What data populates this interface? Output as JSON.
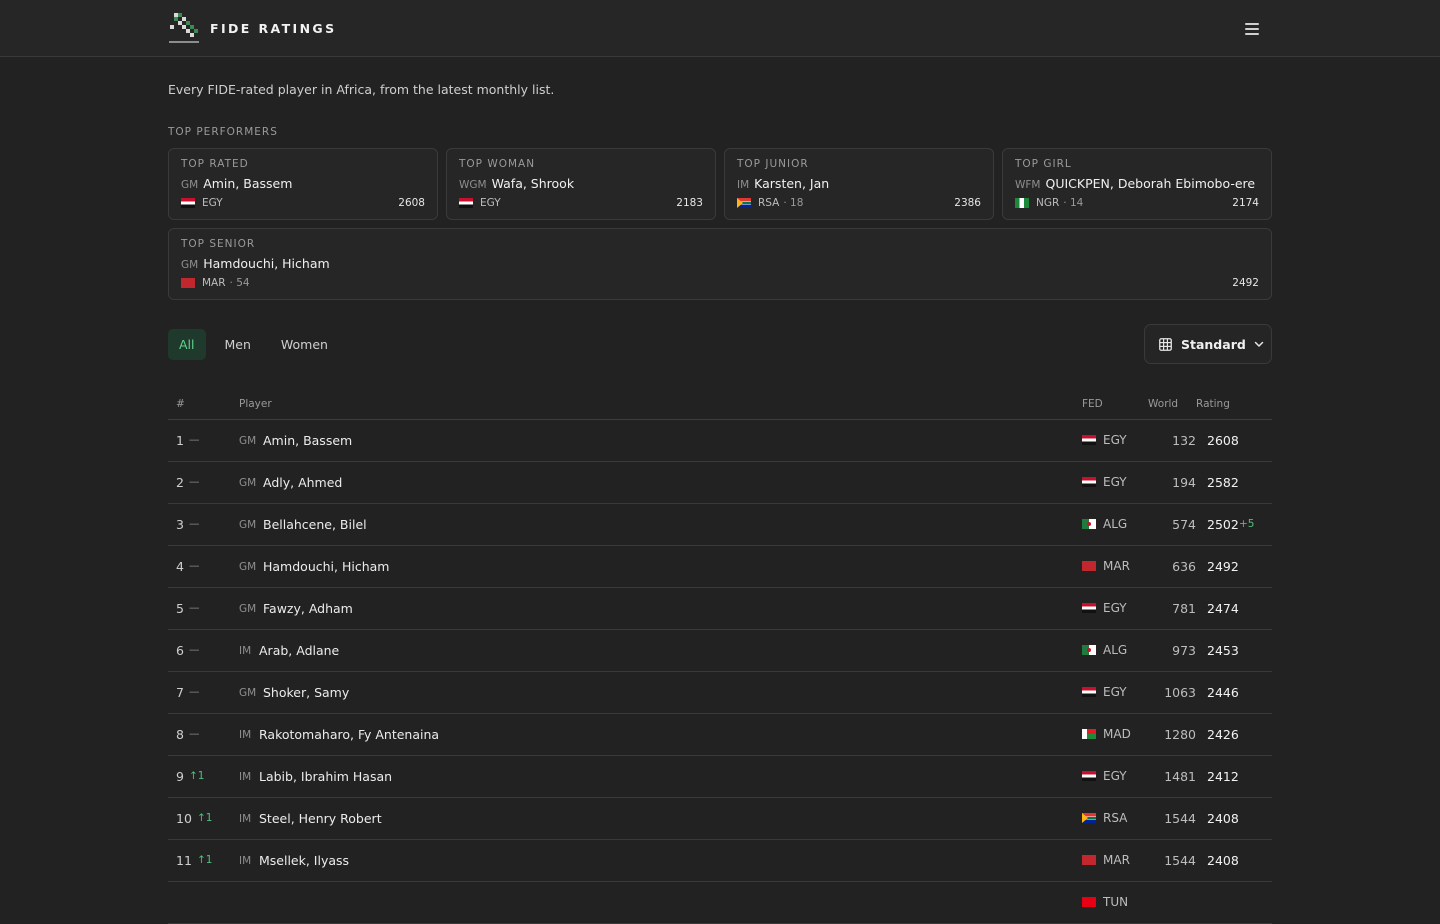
{
  "app": {
    "brand_name": "FIDE RATINGS",
    "menu_icon": "hamburger-menu-icon",
    "logo_icon": "chess-flag-logo"
  },
  "intro": "Every FIDE-rated player in Africa, from the latest monthly list.",
  "performers": {
    "label": "TOP PERFORMERS",
    "cards": [
      {
        "heading": "TOP RATED",
        "title": "GM",
        "name": "Amin, Bassem",
        "fed": "EGY",
        "age": "",
        "rating": "2608",
        "flag": "egy"
      },
      {
        "heading": "TOP WOMAN",
        "title": "WGM",
        "name": "Wafa, Shrook",
        "fed": "EGY",
        "age": "",
        "rating": "2183",
        "flag": "egy"
      },
      {
        "heading": "TOP JUNIOR",
        "title": "IM",
        "name": "Karsten, Jan",
        "fed": "RSA",
        "age": "· 18",
        "rating": "2386",
        "flag": "rsa"
      },
      {
        "heading": "TOP GIRL",
        "title": "WFM",
        "name": "QUICKPEN, Deborah Ebimobo-ere",
        "fed": "NGR",
        "age": "· 14",
        "rating": "2174",
        "flag": "ngr"
      },
      {
        "heading": "TOP SENIOR",
        "title": "GM",
        "name": "Hamdouchi, Hicham",
        "fed": "MAR",
        "age": "· 54",
        "rating": "2492",
        "flag": "mar"
      }
    ]
  },
  "filters": {
    "tabs": [
      "All",
      "Men",
      "Women"
    ],
    "active_tab": "All",
    "format_select": {
      "label": "Standard",
      "icon": "grid-icon",
      "chevron": "chevron-down-icon"
    }
  },
  "table": {
    "headers": {
      "rank": "#",
      "player": "Player",
      "fed": "FED",
      "world": "World",
      "rating": "Rating"
    },
    "rows": [
      {
        "rank": "1",
        "move": "—",
        "title": "GM",
        "name": "Amin, Bassem",
        "fed": "EGY",
        "world": "132",
        "rating": "2608",
        "delta": "",
        "flag": "egy"
      },
      {
        "rank": "2",
        "move": "—",
        "title": "GM",
        "name": "Adly, Ahmed",
        "fed": "EGY",
        "world": "194",
        "rating": "2582",
        "delta": "",
        "flag": "egy"
      },
      {
        "rank": "3",
        "move": "—",
        "title": "GM",
        "name": "Bellahcene, Bilel",
        "fed": "ALG",
        "world": "574",
        "rating": "2502",
        "delta": "+5",
        "flag": "alg"
      },
      {
        "rank": "4",
        "move": "—",
        "title": "GM",
        "name": "Hamdouchi, Hicham",
        "fed": "MAR",
        "world": "636",
        "rating": "2492",
        "delta": "",
        "flag": "mar"
      },
      {
        "rank": "5",
        "move": "—",
        "title": "GM",
        "name": "Fawzy, Adham",
        "fed": "EGY",
        "world": "781",
        "rating": "2474",
        "delta": "",
        "flag": "egy"
      },
      {
        "rank": "6",
        "move": "—",
        "title": "IM",
        "name": "Arab, Adlane",
        "fed": "ALG",
        "world": "973",
        "rating": "2453",
        "delta": "",
        "flag": "alg"
      },
      {
        "rank": "7",
        "move": "—",
        "title": "GM",
        "name": "Shoker, Samy",
        "fed": "EGY",
        "world": "1063",
        "rating": "2446",
        "delta": "",
        "flag": "egy"
      },
      {
        "rank": "8",
        "move": "—",
        "title": "IM",
        "name": "Rakotomaharo, Fy Antenaina",
        "fed": "MAD",
        "world": "1280",
        "rating": "2426",
        "delta": "",
        "flag": "mad"
      },
      {
        "rank": "9",
        "move": "↑1",
        "title": "IM",
        "name": "Labib, Ibrahim Hasan",
        "fed": "EGY",
        "world": "1481",
        "rating": "2412",
        "delta": "",
        "flag": "egy"
      },
      {
        "rank": "10",
        "move": "↑1",
        "title": "IM",
        "name": "Steel, Henry Robert",
        "fed": "RSA",
        "world": "1544",
        "rating": "2408",
        "delta": "",
        "flag": "rsa"
      },
      {
        "rank": "11",
        "move": "↑1",
        "title": "IM",
        "name": "Msellek, Ilyass",
        "fed": "MAR",
        "world": "1544",
        "rating": "2408",
        "delta": "",
        "flag": "mar"
      },
      {
        "rank": "",
        "move": "",
        "title": "",
        "name": "",
        "fed": "TUN",
        "world": "",
        "rating": "",
        "delta": "",
        "flag": "tun"
      }
    ]
  }
}
